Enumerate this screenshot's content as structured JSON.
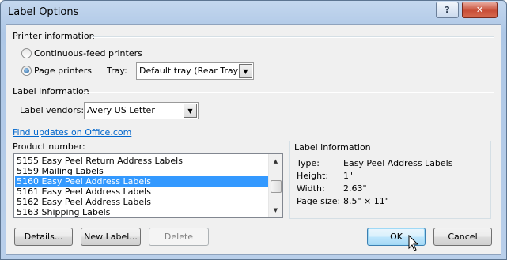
{
  "window": {
    "title": "Label Options",
    "help_glyph": "?",
    "close_glyph": "✕"
  },
  "printer_info": {
    "heading": "Printer information",
    "continuous_label": "Continuous-feed printers",
    "page_label": "Page printers",
    "selected": "page",
    "tray_label": "Tray:",
    "tray_value": "Default tray (Rear Tray)"
  },
  "label_info": {
    "heading": "Label information",
    "vendor_label": "Label vendors:",
    "vendor_value": "Avery US Letter",
    "find_updates_link": "Find updates on Office.com"
  },
  "product": {
    "label": "Product number:",
    "items": [
      "5155 Easy Peel Return Address Labels",
      "5159 Mailing Labels",
      "5160 Easy Peel Address Labels",
      "5161 Easy Peel Address Labels",
      "5162 Easy Peel Address Labels",
      "5163 Shipping Labels"
    ],
    "selected": "5160 Easy Peel Address Labels"
  },
  "details_panel": {
    "heading": "Label information",
    "type_label": "Type:",
    "type_value": "Easy Peel Address Labels",
    "height_label": "Height:",
    "height_value": "1\"",
    "width_label": "Width:",
    "width_value": "2.63\"",
    "pagesize_label": "Page size:",
    "pagesize_value": "8.5\" × 11\""
  },
  "buttons": {
    "details": "Details...",
    "new_label": "New Label...",
    "delete": "Delete",
    "ok": "OK",
    "cancel": "Cancel"
  },
  "colors": {
    "selection": "#3399ff",
    "link": "#0066cc",
    "titlebar": "#aec7e6"
  }
}
